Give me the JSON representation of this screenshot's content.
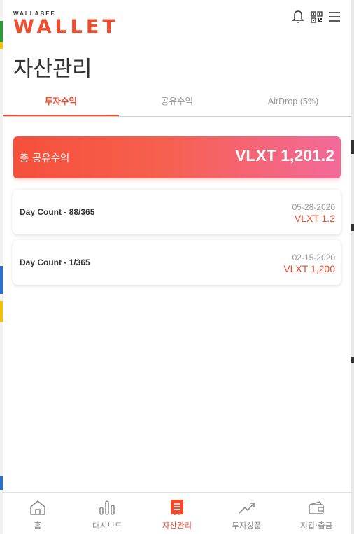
{
  "header": {
    "logo_small": "WALLABEE",
    "logo_big": "WALLET",
    "icons": [
      "bell-icon",
      "qr-code-icon",
      "menu-icon"
    ]
  },
  "page_title": "자산관리",
  "tabs": [
    {
      "label": "투자수익",
      "active": true
    },
    {
      "label": "공유수익",
      "active": false
    },
    {
      "label": "AirDrop (5%)",
      "active": false
    }
  ],
  "total": {
    "label": "총 공유수익",
    "value": "VLXT 1,201.2"
  },
  "items": [
    {
      "label": "Day Count - 88/365",
      "date": "05-28-2020",
      "amount": "VLXT 1.2"
    },
    {
      "label": "Day Count - 1/365",
      "date": "02-15-2020",
      "amount": "VLXT 1,200"
    }
  ],
  "bottom_nav": [
    {
      "label": "홈",
      "icon": "home-icon",
      "active": false
    },
    {
      "label": "대시보드",
      "icon": "bar-chart-icon",
      "active": false
    },
    {
      "label": "자산관리",
      "icon": "receipt-icon",
      "active": true
    },
    {
      "label": "투자상품",
      "icon": "trending-up-icon",
      "active": false
    },
    {
      "label": "지갑·출금",
      "icon": "wallet-icon",
      "active": false
    }
  ],
  "colors": {
    "accent": "#f04b2d",
    "gradient_start": "#f5503b",
    "gradient_end": "#f36a9a",
    "inactive": "#888888"
  }
}
